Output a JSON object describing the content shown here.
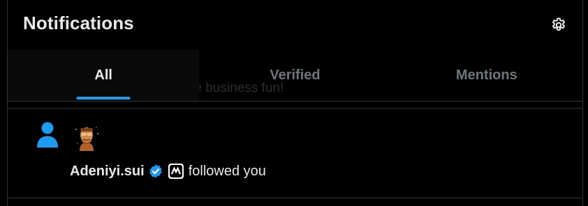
{
  "header": {
    "title": "Notifications",
    "settings_icon": "gear-icon"
  },
  "tabs": [
    {
      "label": "All",
      "active": true
    },
    {
      "label": "Verified",
      "active": false
    },
    {
      "label": "Mentions",
      "active": false
    }
  ],
  "ghost_text": "ourse, and experience business fun!",
  "notifications": [
    {
      "type_icon": "person-icon",
      "user_name": "Adeniyi.sui",
      "verified": true,
      "affiliate_badge": "affiliate-logo-icon",
      "action": "followed you"
    }
  ],
  "colors": {
    "background": "#000000",
    "accent": "#1d9bf0",
    "text_primary": "#e7e9ea",
    "text_secondary": "#71767b",
    "border": "#2f3336"
  }
}
